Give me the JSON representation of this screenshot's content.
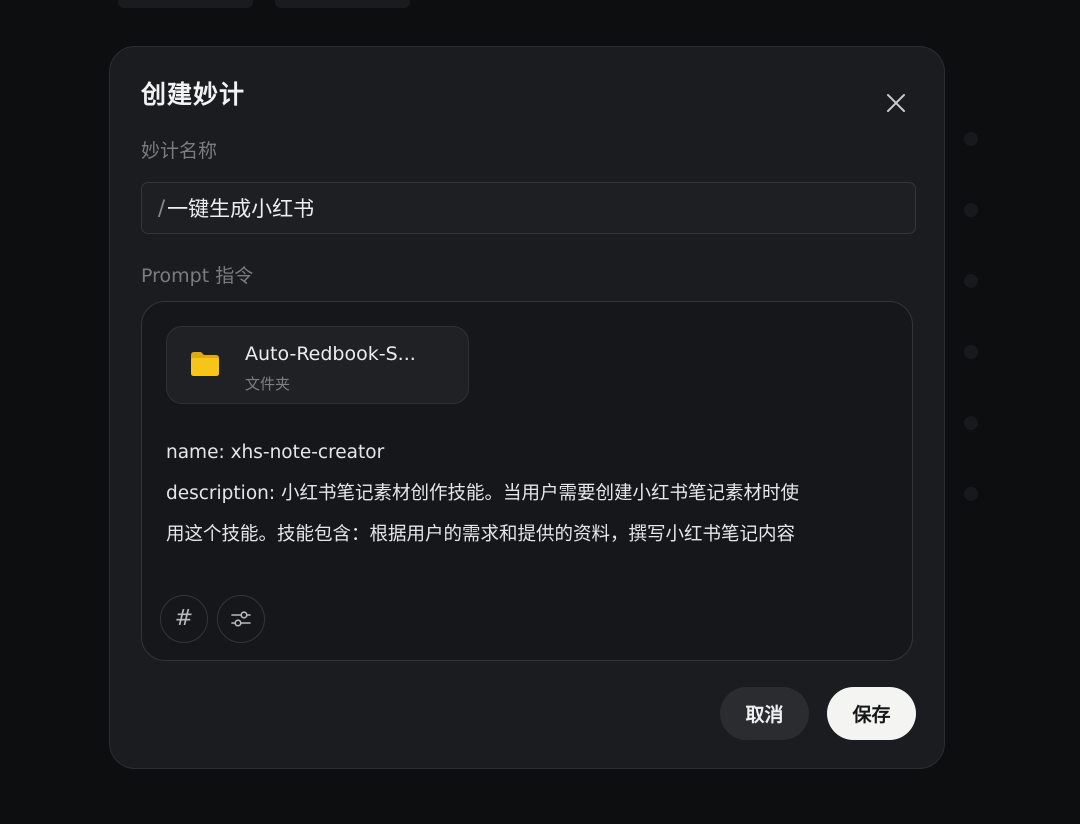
{
  "dialog": {
    "title": "创建妙计",
    "name_label": "妙计名称",
    "name_prefix": "/",
    "name_value": "一键生成小红书",
    "prompt_label": "Prompt 指令",
    "attachment": {
      "name": "Auto-Redbook-S...",
      "type": "文件夹",
      "icon": "folder-icon"
    },
    "prompt_lines": [
      "name: xhs-note-creator",
      "description: 小红书笔记素材创作技能。当用户需要创建小红书笔记素材时使",
      "用这个技能。技能包含：根据用户的需求和提供的资料，撰写小红书笔记内容"
    ],
    "tools": [
      {
        "icon": "hash-icon",
        "glyph": "#"
      },
      {
        "icon": "sliders-icon"
      }
    ],
    "cancel_label": "取消",
    "save_label": "保存"
  },
  "colors": {
    "background": "#0d0e10",
    "modal": "#1b1c1f",
    "prompt_box": "#16171a",
    "folder": "#f7c419",
    "save_button": "#f4f4f2"
  }
}
